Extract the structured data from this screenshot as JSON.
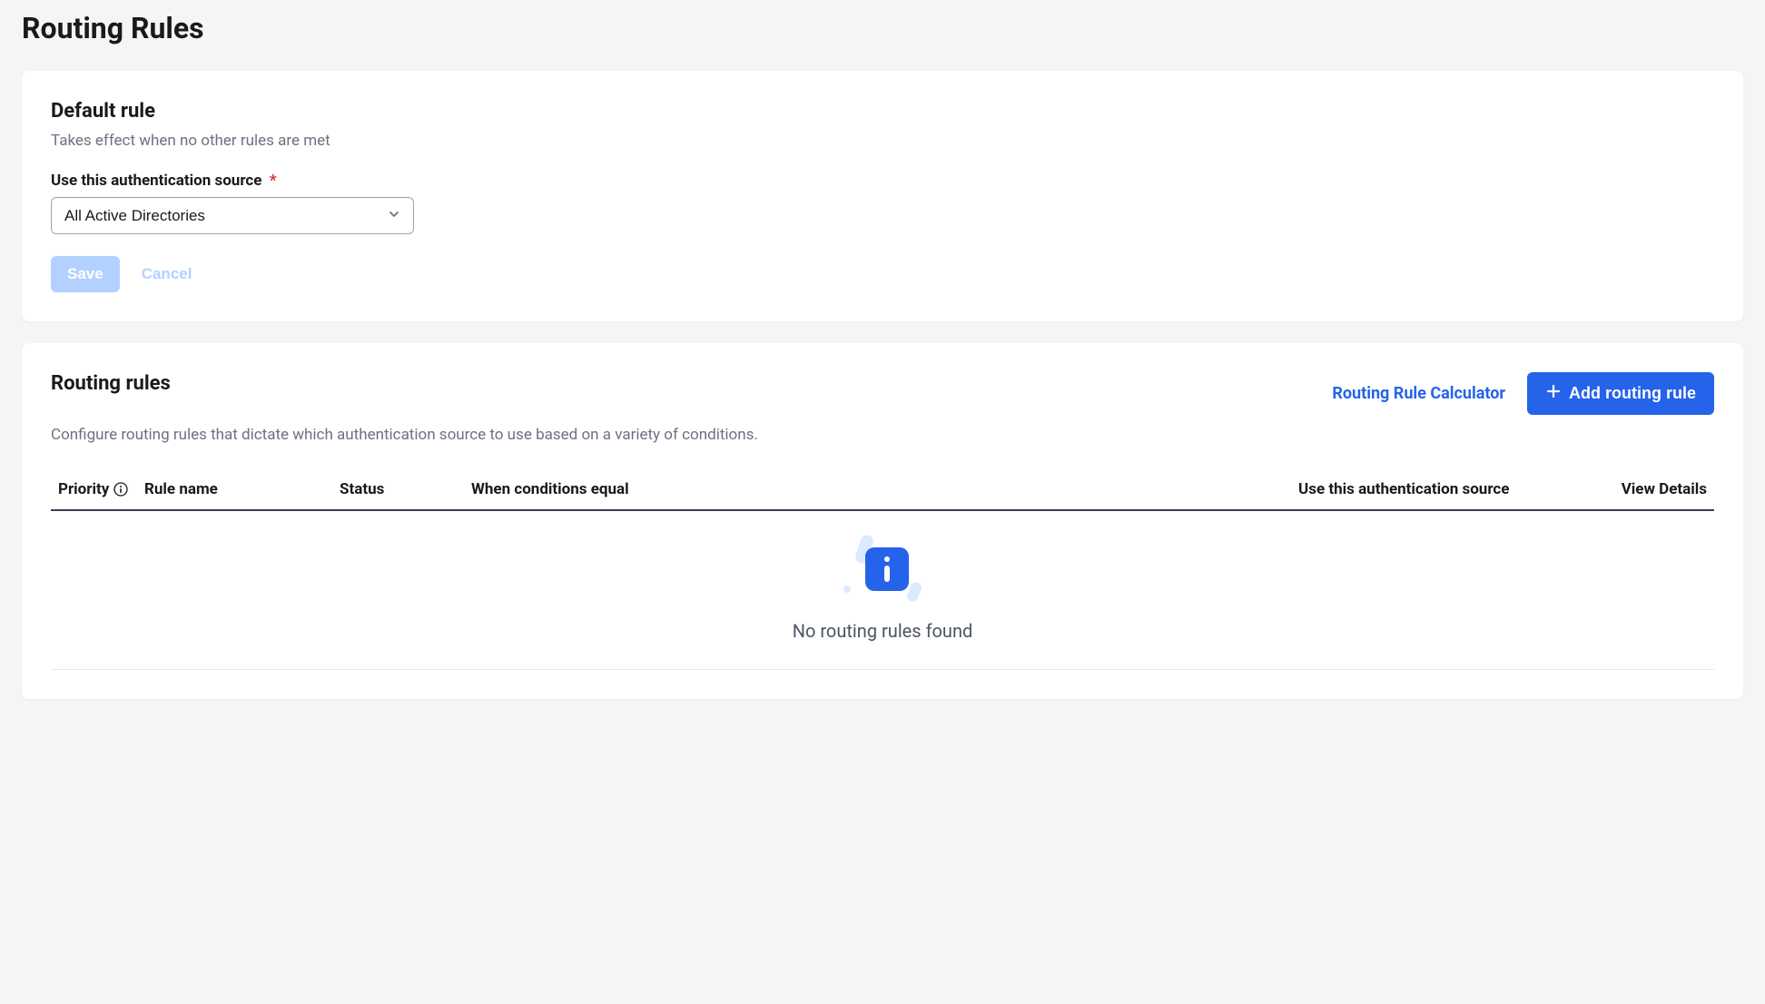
{
  "page": {
    "title": "Routing Rules"
  },
  "default_rule": {
    "title": "Default rule",
    "subtitle": "Takes effect when no other rules are met",
    "field_label": "Use this authentication source",
    "selected_value": "All Active Directories",
    "save_label": "Save",
    "cancel_label": "Cancel"
  },
  "routing_rules": {
    "title": "Routing rules",
    "description": "Configure routing rules that dictate which authentication source to use based on a variety of conditions.",
    "calculator_link": "Routing Rule Calculator",
    "add_button": "Add routing rule",
    "columns": {
      "priority": "Priority",
      "rule_name": "Rule name",
      "status": "Status",
      "conditions": "When conditions equal",
      "auth_source": "Use this authentication source",
      "view_details": "View Details"
    },
    "empty_message": "No routing rules found"
  }
}
